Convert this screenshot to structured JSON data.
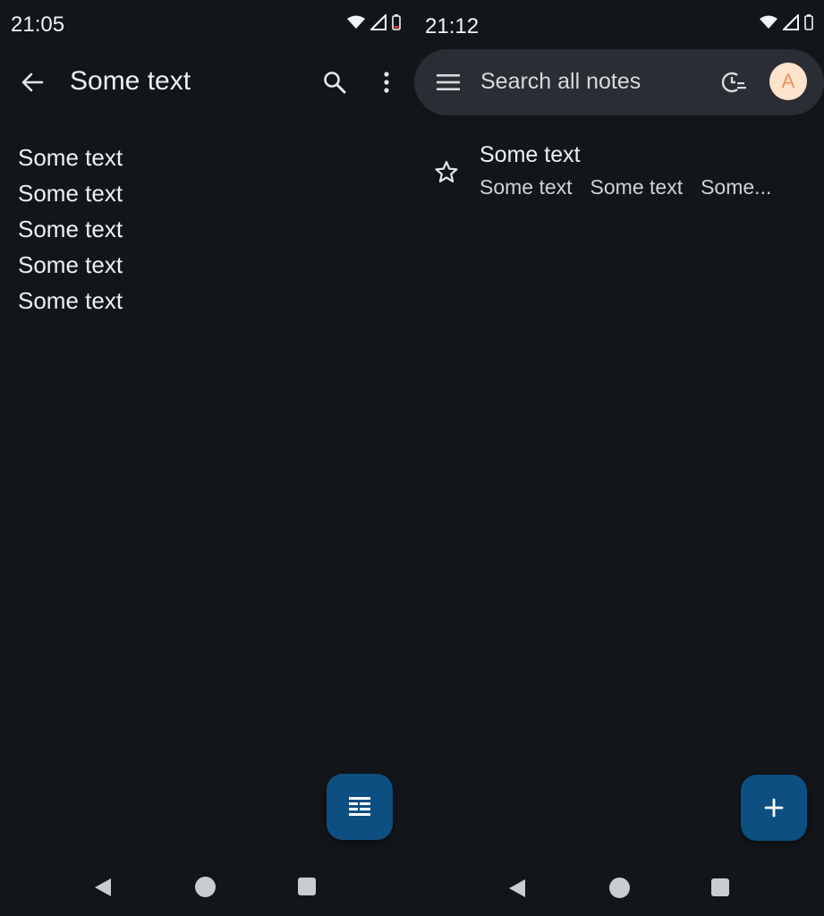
{
  "left": {
    "status_time": "21:05",
    "title": "Some text",
    "lines": [
      "Some text",
      "Some text",
      "Some text",
      "Some text",
      "Some text"
    ]
  },
  "right": {
    "status_time": "21:12",
    "search_placeholder": "Search all notes",
    "avatar_letter": "A",
    "note": {
      "title": "Some text",
      "preview": [
        "Some text",
        "Some text",
        "Some..."
      ]
    }
  },
  "colors": {
    "background": "#12151a",
    "fab": "#0d4f80",
    "search_bar": "#2a2d33",
    "avatar_bg": "#fde3cc",
    "avatar_fg": "#e8945a"
  },
  "icons": [
    "back-arrow-icon",
    "search-icon",
    "more-vert-icon",
    "note-view-icon",
    "menu-icon",
    "reminder-icon",
    "star-outline-icon",
    "add-icon",
    "wifi-icon",
    "signal-icon",
    "battery-icon"
  ]
}
